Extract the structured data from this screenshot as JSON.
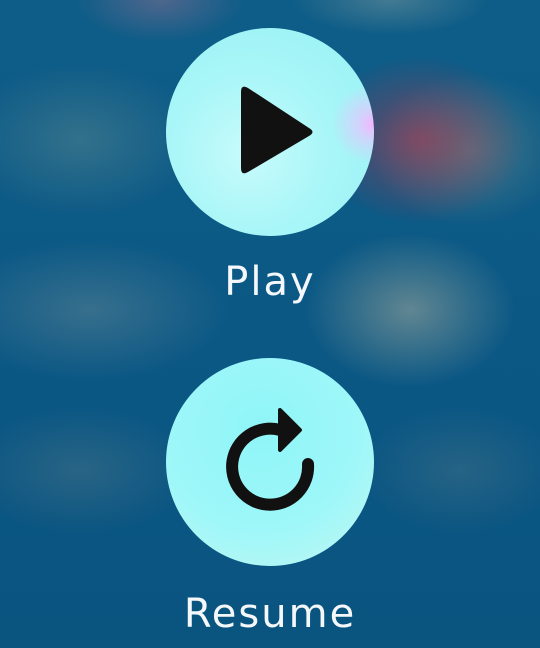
{
  "actions": {
    "play": {
      "label": "Play",
      "icon": "play-icon"
    },
    "resume": {
      "label": "Resume",
      "icon": "rotate-clockwise-icon"
    }
  },
  "colors": {
    "background": "#0c5a86",
    "button_fill": "#9ef6f8",
    "icon": "#111111",
    "label_text": "#f4f8fb"
  }
}
